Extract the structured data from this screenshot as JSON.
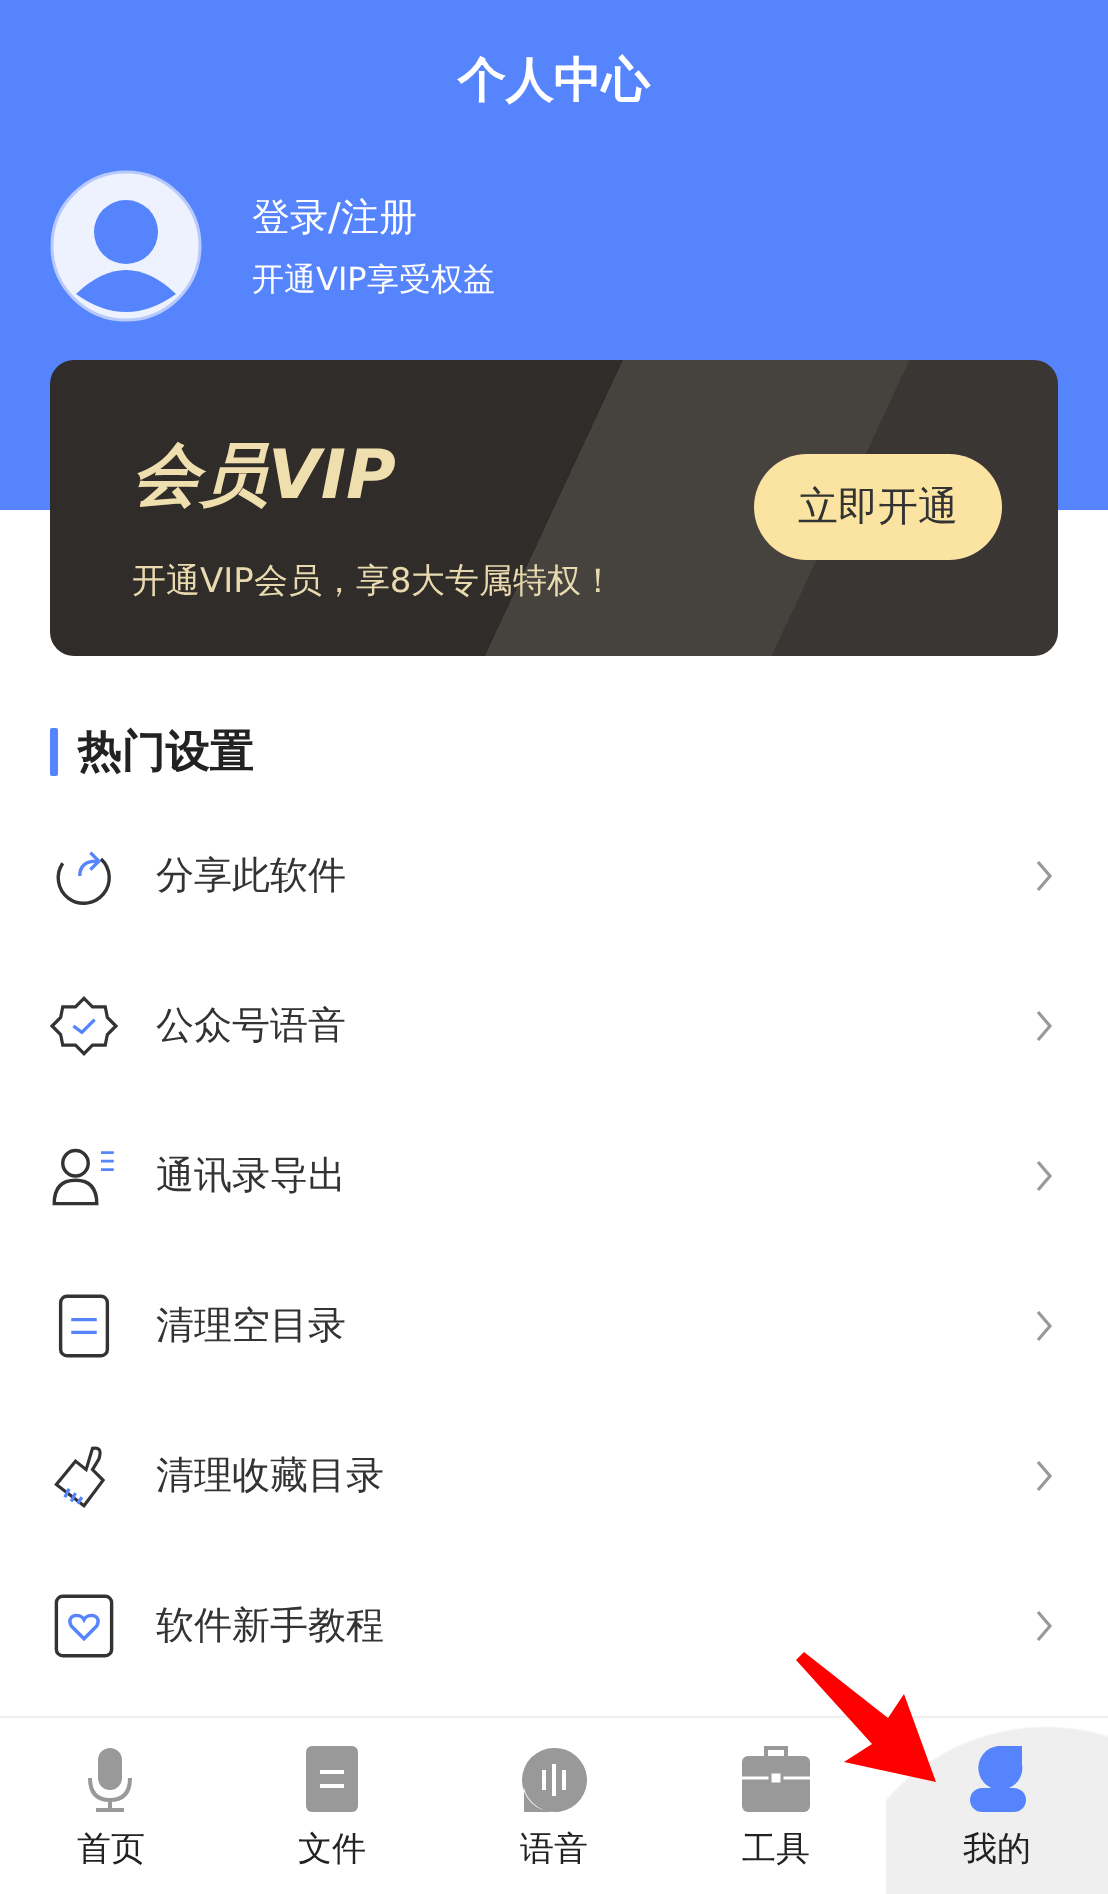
{
  "header": {
    "title": "个人中心"
  },
  "profile": {
    "name": "登录/注册",
    "subtitle": "开通VIP享受权益"
  },
  "vip_card": {
    "title": "会员VIP",
    "description": "开通VIP会员，享8大专属特权！",
    "button": "立即开通"
  },
  "section": {
    "title": "热门设置"
  },
  "menu_items": [
    {
      "kind": "share",
      "label": "分享此软件"
    },
    {
      "kind": "badge",
      "label": "公众号语音"
    },
    {
      "kind": "contacts",
      "label": "通讯录导出"
    },
    {
      "kind": "document",
      "label": "清理空目录"
    },
    {
      "kind": "brush",
      "label": "清理收藏目录"
    },
    {
      "kind": "heart",
      "label": "软件新手教程"
    }
  ],
  "tab_bar": [
    {
      "kind": "mic",
      "label": "首页",
      "selected": false
    },
    {
      "kind": "file",
      "label": "文件",
      "selected": false
    },
    {
      "kind": "voice",
      "label": "语音",
      "selected": false
    },
    {
      "kind": "toolbox",
      "label": "工具",
      "selected": false
    },
    {
      "kind": "person",
      "label": "我的",
      "selected": true
    }
  ],
  "annotation": {
    "kind": "arrow"
  }
}
